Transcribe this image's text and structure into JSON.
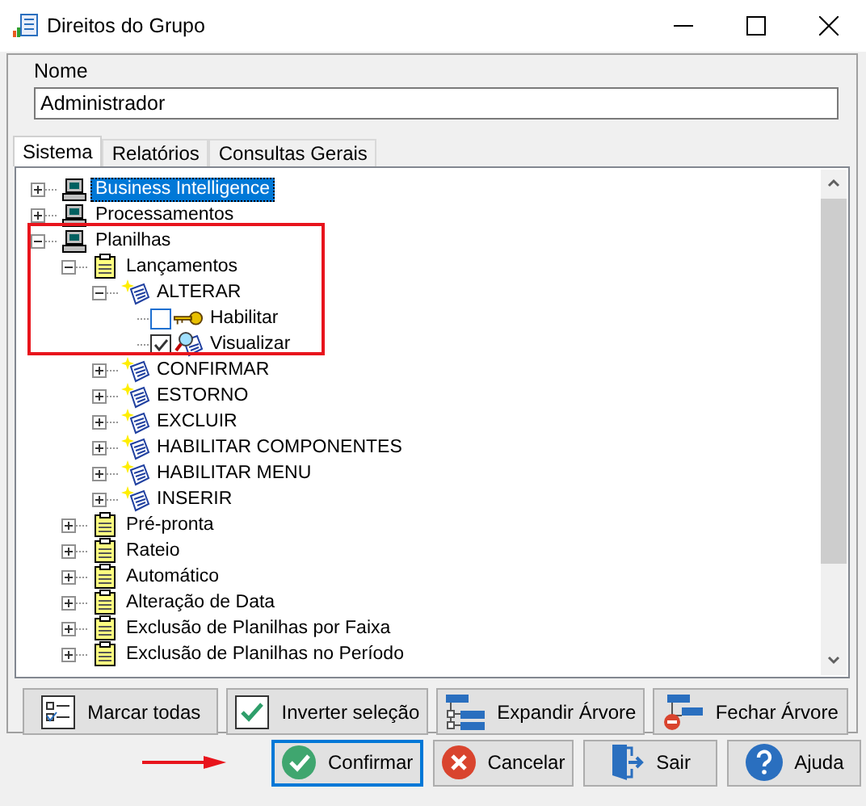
{
  "window": {
    "title": "Direitos do Grupo"
  },
  "name_field": {
    "label": "Nome",
    "value": "Administrador"
  },
  "tabs": [
    {
      "label": "Sistema",
      "selected": true
    },
    {
      "label": "Relatórios",
      "selected": false
    },
    {
      "label": "Consultas Gerais",
      "selected": false
    }
  ],
  "tree": {
    "items": [
      {
        "label": "Business Intelligence",
        "kind": "module",
        "expanded": false,
        "selected": true
      },
      {
        "label": "Processamentos",
        "kind": "module",
        "expanded": false,
        "selected": false
      },
      {
        "label": "Planilhas",
        "kind": "module",
        "expanded": true,
        "selected": false,
        "children": [
          {
            "label": "Lançamentos",
            "kind": "sheet",
            "expanded": true,
            "selected": false,
            "children": [
              {
                "label": "ALTERAR",
                "kind": "action",
                "expanded": true,
                "selected": false,
                "children": [
                  {
                    "label": "Habilitar",
                    "kind": "key",
                    "checked": false,
                    "selected": false
                  },
                  {
                    "label": "Visualizar",
                    "kind": "viewer",
                    "checked": true,
                    "selected": false
                  }
                ]
              },
              {
                "label": "CONFIRMAR",
                "kind": "action",
                "expanded": false,
                "selected": false
              },
              {
                "label": "ESTORNO",
                "kind": "action",
                "expanded": false,
                "selected": false
              },
              {
                "label": "EXCLUIR",
                "kind": "action",
                "expanded": false,
                "selected": false
              },
              {
                "label": "HABILITAR COMPONENTES",
                "kind": "action",
                "expanded": false,
                "selected": false
              },
              {
                "label": "HABILITAR MENU",
                "kind": "action",
                "expanded": false,
                "selected": false
              },
              {
                "label": "INSERIR",
                "kind": "action",
                "expanded": false,
                "selected": false
              }
            ]
          },
          {
            "label": "Pré-pronta",
            "kind": "sheet",
            "expanded": false,
            "selected": false
          },
          {
            "label": "Rateio",
            "kind": "sheet",
            "expanded": false,
            "selected": false
          },
          {
            "label": "Automático",
            "kind": "sheet",
            "expanded": false,
            "selected": false
          },
          {
            "label": "Alteração de Data",
            "kind": "sheet",
            "expanded": false,
            "selected": false
          },
          {
            "label": "Exclusão de Planilhas por Faixa",
            "kind": "sheet",
            "expanded": false,
            "selected": false
          },
          {
            "label": "Exclusão de Planilhas no Período",
            "kind": "sheet",
            "expanded": false,
            "selected": false
          }
        ]
      }
    ]
  },
  "tree_buttons": [
    {
      "label": "Marcar todas",
      "kind": "checklist"
    },
    {
      "label": "Inverter seleção",
      "kind": "check"
    },
    {
      "label": "Expandir Árvore",
      "kind": "expand"
    },
    {
      "label": "Fechar Árvore",
      "kind": "collapse"
    }
  ],
  "footer_buttons": [
    {
      "label": "Confirmar",
      "kind": "confirm",
      "focused": true
    },
    {
      "label": "Cancelar",
      "kind": "cancel",
      "focused": false
    },
    {
      "label": "Sair",
      "kind": "exit",
      "focused": false
    },
    {
      "label": "Ajuda",
      "kind": "help",
      "focused": false
    }
  ]
}
